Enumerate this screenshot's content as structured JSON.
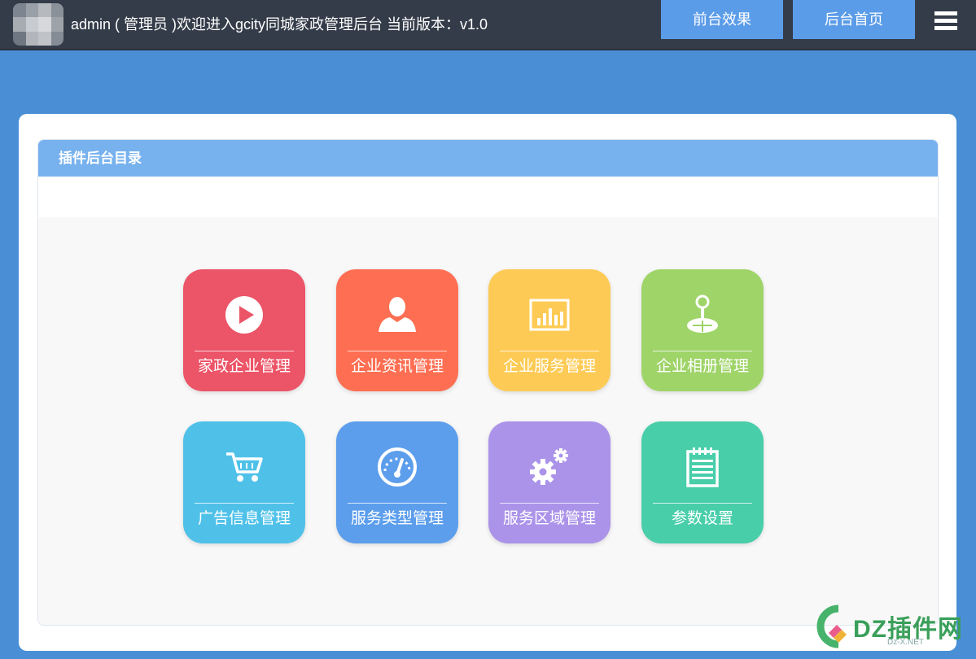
{
  "header": {
    "welcome_text": "admin ( 管理员 )欢迎进入gcity同城家政管理后台 当前版本：v1.0",
    "front_button": "前台效果",
    "back_button": "后台首页",
    "menu_icon": "hamburger-menu-icon"
  },
  "panel": {
    "title": "插件后台目录"
  },
  "tiles": [
    {
      "label": "家政企业管理",
      "icon": "play-icon",
      "color": "#ec5467"
    },
    {
      "label": "企业资讯管理",
      "icon": "user-icon",
      "color": "#fd6e52"
    },
    {
      "label": "企业服务管理",
      "icon": "bar-chart-icon",
      "color": "#fdcb55"
    },
    {
      "label": "企业相册管理",
      "icon": "joystick-icon",
      "color": "#9fd469"
    },
    {
      "label": "广告信息管理",
      "icon": "shopping-cart-icon",
      "color": "#4fc1e9"
    },
    {
      "label": "服务类型管理",
      "icon": "dashboard-icon",
      "color": "#5c9eec"
    },
    {
      "label": "服务区域管理",
      "icon": "gears-icon",
      "color": "#ab93e9"
    },
    {
      "label": "参数设置",
      "icon": "notepad-icon",
      "color": "#48cea9"
    }
  ],
  "watermark": {
    "text": "DZ插件网",
    "sub": "Dz-X.NET"
  }
}
